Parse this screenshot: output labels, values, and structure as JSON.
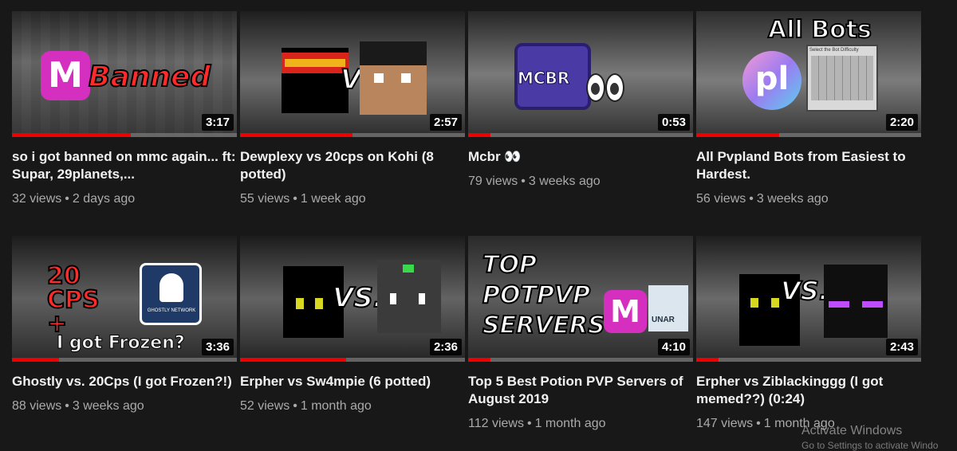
{
  "videos": [
    {
      "title": "so i got banned on mmc again... ft: Supar, 29planets,...",
      "views": "32 views",
      "age": "2 days ago",
      "duration": "3:17",
      "progress": 0.53,
      "thumb_text": "Banned",
      "thumb_logo": "M"
    },
    {
      "title": "Dewplexy vs 20cps on Kohi (8 potted)",
      "views": "55 views",
      "age": "1 week ago",
      "duration": "2:57",
      "progress": 0.5,
      "thumb_text": "VS."
    },
    {
      "title": "Mcbr 👀",
      "views": "79 views",
      "age": "3 weeks ago",
      "duration": "0:53",
      "progress": 0.1,
      "thumb_text": "MCBR"
    },
    {
      "title": "All Pvpland Bots from Easiest to Hardest.",
      "views": "56 views",
      "age": "3 weeks ago",
      "duration": "2:20",
      "progress": 0.37,
      "thumb_text": "All Bots",
      "thumb_logo": "pl",
      "thumb_caption": "Select the Bot Difficulty"
    },
    {
      "title": "Ghostly vs. 20Cps (I got Frozen?!)",
      "views": "88 views",
      "age": "3 weeks ago",
      "duration": "3:36",
      "progress": 0.21,
      "thumb_text": "20 CPS +",
      "thumb_caption": "I got Frozen?",
      "thumb_logo": "GHOSTLY NETWORK"
    },
    {
      "title": "Erpher vs Sw4mpie (6 potted)",
      "views": "52 views",
      "age": "1 month ago",
      "duration": "2:36",
      "progress": 0.47,
      "thumb_text": "VS."
    },
    {
      "title": "Top 5 Best Potion PVP Servers of August 2019",
      "views": "112 views",
      "age": "1 month ago",
      "duration": "4:10",
      "progress": 0.1,
      "thumb_text": "TOP POTPVP SERVERS",
      "thumb_logo": "M",
      "thumb_caption": "UNAR"
    },
    {
      "title": "Erpher vs Ziblackinggg (I got memed??) (0:24)",
      "views": "147 views",
      "age": "1 month ago",
      "duration": "2:43",
      "progress": 0.1,
      "thumb_text": "VS."
    }
  ],
  "watermark": {
    "title": "Activate Windows",
    "sub": "Go to Settings to activate Windo"
  },
  "colors": {
    "progress": "#ee0000",
    "pink": "#d42fbf",
    "bg": "#181818"
  }
}
